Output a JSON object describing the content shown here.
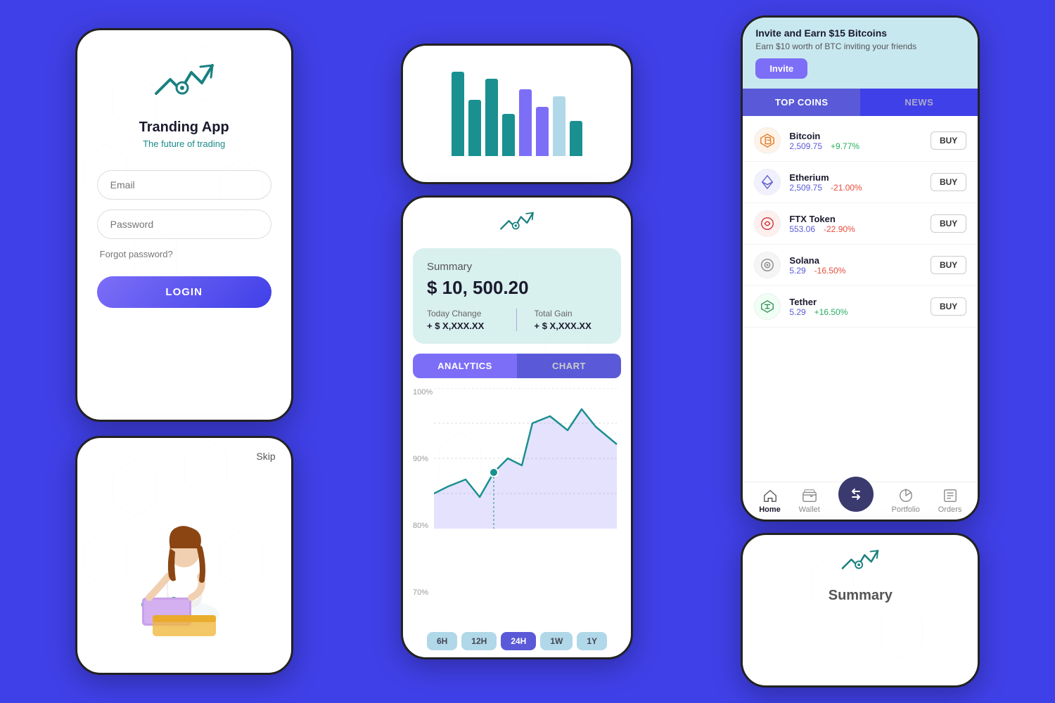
{
  "app": {
    "name": "Tranding App",
    "subtitle": "The future of trading",
    "bg_color": "#4040e8"
  },
  "login": {
    "email_placeholder": "Email",
    "password_placeholder": "Password",
    "forgot_label": "Forgot password?",
    "login_btn": "LOGIN"
  },
  "onboarding": {
    "skip_label": "Skip"
  },
  "analytics": {
    "summary_label": "Summary",
    "amount": "$ 10, 500.20",
    "today_change_label": "Today Change",
    "today_change_value": "+ $ X,XXX.XX",
    "total_gain_label": "Total Gain",
    "total_gain_value": "+ $ X,XXX.XX",
    "tab_analytics": "ANALYTICS",
    "tab_chart": "CHART",
    "chart_labels": [
      "100%",
      "90%",
      "80%",
      "70%"
    ],
    "time_buttons": [
      "6H",
      "12H",
      "24H",
      "1W",
      "1Y"
    ],
    "active_time": "24H"
  },
  "crypto": {
    "invite_title": "Invite and Earn $15 Bitcoins",
    "invite_sub": "Earn $10 worth of BTC inviting your friends",
    "invite_btn": "Invite",
    "tab_top_coins": "TOP COINS",
    "tab_news": "NEWS",
    "coins": [
      {
        "name": "Bitcoin",
        "price": "2,509.75",
        "change": "+9.77%",
        "positive": true
      },
      {
        "name": "Etherium",
        "price": "2,509.75",
        "change": "-21.00%",
        "positive": false
      },
      {
        "name": "FTX Token",
        "price": "553.06",
        "change": "-22.90%",
        "positive": false
      },
      {
        "name": "Solana",
        "price": "5.29",
        "change": "-16.50%",
        "positive": false
      },
      {
        "name": "Tether",
        "price": "5.29",
        "change": "+16.50%",
        "positive": true
      }
    ],
    "buy_label": "BUY",
    "nav": {
      "home": "Home",
      "wallet": "Wallet",
      "portfolio": "Portfolio",
      "orders": "Orders"
    }
  },
  "summary_partial": {
    "label": "Summary"
  }
}
